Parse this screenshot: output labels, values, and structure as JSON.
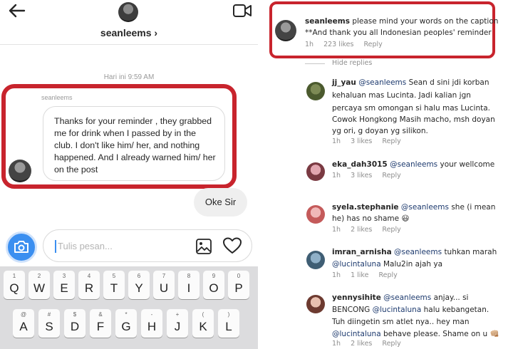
{
  "dm": {
    "header": {
      "username": "seanleems ›"
    },
    "timestamp": "Hari ini 9:59 AM",
    "sender_name": "seanleems",
    "message": "Thanks for your reminder , they grabbed me for drink when I passed by in the club. I don't like him/ her, and nothing happened. And I already warned him/ her on the post",
    "reply": "Oke Sir",
    "composer": {
      "placeholder": "Tulis pesan..."
    },
    "accent_color": "#3b8ff0",
    "highlight_color": "#c8242d"
  },
  "keyboard": {
    "row1": [
      {
        "alt": "1",
        "key": "Q"
      },
      {
        "alt": "2",
        "key": "W"
      },
      {
        "alt": "3",
        "key": "E"
      },
      {
        "alt": "4",
        "key": "R"
      },
      {
        "alt": "5",
        "key": "T"
      },
      {
        "alt": "6",
        "key": "Y"
      },
      {
        "alt": "7",
        "key": "U"
      },
      {
        "alt": "8",
        "key": "I"
      },
      {
        "alt": "9",
        "key": "O"
      },
      {
        "alt": "0",
        "key": "P"
      }
    ],
    "row2": [
      {
        "alt": "@",
        "key": "A"
      },
      {
        "alt": "#",
        "key": "S"
      },
      {
        "alt": "$",
        "key": "D"
      },
      {
        "alt": "&",
        "key": "F"
      },
      {
        "alt": "*",
        "key": "G"
      },
      {
        "alt": "-",
        "key": "H"
      },
      {
        "alt": "+",
        "key": "J"
      },
      {
        "alt": "(",
        "key": "K"
      },
      {
        "alt": ")",
        "key": "L"
      }
    ]
  },
  "comments": {
    "main": {
      "username": "seanleems",
      "text1": "please mind your words on the caption",
      "text2": "**And thank you all Indonesian peoples' reminder",
      "time": "1h",
      "likes": "223 likes",
      "reply": "Reply"
    },
    "hide_replies": "Hide replies",
    "replies": [
      {
        "username": "jj_yau",
        "mention": "@seanleems",
        "line1": "Sean d sini jdi korban",
        "line2": "kehaluan mas Lucinta. Jadi kalian jgn",
        "line3": "percaya sm omongan si halu mas Lucinta.",
        "line4": "Cowok Hongkong Masih macho, msh doyan",
        "line5": "yg ori, g doyan yg silikon.",
        "time": "1h",
        "likes": "3 likes",
        "reply": "Reply"
      },
      {
        "username": "eka_dah3015",
        "mention": "@seanleems",
        "line1": "your wellcome",
        "time": "1h",
        "likes": "3 likes",
        "reply": "Reply"
      },
      {
        "username": "syela.stephanie",
        "mention": "@seanleems",
        "line1": "she (i mean",
        "line2": "he) has no shame",
        "emoji": "😃",
        "time": "1h",
        "likes": "2 likes",
        "reply": "Reply"
      },
      {
        "username": "imran_arnisha",
        "mention": "@seanleems",
        "line1": "tuhkan marah",
        "mention2": "@lucintaluna",
        "line2": "Malu2in ajah ya",
        "time": "1h",
        "likes": "1 like",
        "reply": "Reply"
      },
      {
        "username": "yennysihite",
        "mention": "@seanleems",
        "line1": "anjay... si",
        "line2a": "BENCONG",
        "mention2": "@lucintaluna",
        "line2b": "halu kebangetan.",
        "line3": "Tuh diingetin sm atlet nya.. hey man",
        "mention3": "@lucintaluna",
        "line4": "behave please. Shame on u",
        "emoji": "👊🏼",
        "time": "1h",
        "likes": "2 likes",
        "reply": "Reply"
      }
    ]
  }
}
